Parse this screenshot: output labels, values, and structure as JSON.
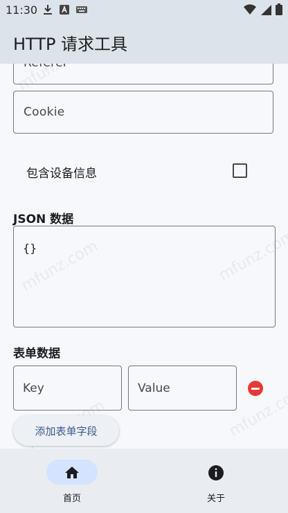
{
  "status_bar": {
    "time": "11:30",
    "left_icons": [
      "download-icon",
      "a-badge-icon",
      "keyboard-icon"
    ],
    "right_icons": [
      "wifi-icon",
      "signal-icon",
      "battery-icon"
    ]
  },
  "app_bar": {
    "title": "HTTP 请求工具"
  },
  "form": {
    "referer_placeholder": "Referer",
    "cookie_placeholder": "Cookie",
    "include_device_info_label": "包含设备信息",
    "include_device_info_checked": false,
    "json_section_title": "JSON 数据",
    "json_value": "{}",
    "form_section_title": "表单数据",
    "key_placeholder": "Key",
    "value_placeholder": "Value",
    "add_field_label": "添加表单字段"
  },
  "watermark_text": "mfunz.com",
  "bottom_nav": {
    "items": [
      {
        "label": "首页",
        "icon": "home-icon",
        "selected": true
      },
      {
        "label": "关于",
        "icon": "info-icon",
        "selected": false
      }
    ]
  },
  "colors": {
    "app_bar_bg": "#DDE3EA",
    "page_bg": "#F7F8FC",
    "nav_indicator": "#D4E3FF",
    "remove_button": "#E53935"
  }
}
